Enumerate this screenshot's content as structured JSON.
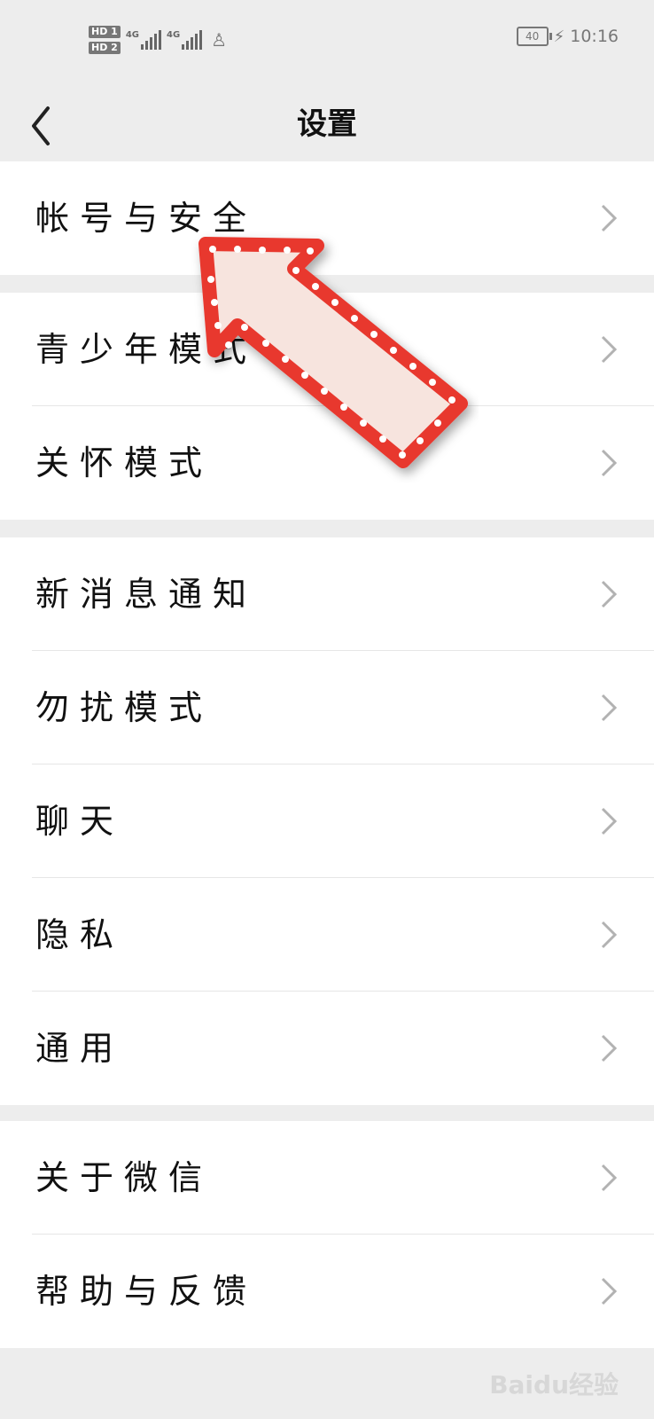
{
  "status_bar": {
    "sim1": "HD 1",
    "sim2": "HD 2",
    "net1": "4G",
    "net2": "4G",
    "battery": "40",
    "time": "10:16"
  },
  "header": {
    "title": "设置"
  },
  "settings": {
    "group1": [
      {
        "label": "帐号与安全"
      }
    ],
    "group2": [
      {
        "label": "青少年模式"
      },
      {
        "label": "关怀模式"
      }
    ],
    "group3": [
      {
        "label": "新消息通知"
      },
      {
        "label": "勿扰模式"
      },
      {
        "label": "聊天"
      },
      {
        "label": "隐私"
      },
      {
        "label": "通用"
      }
    ],
    "group4": [
      {
        "label": "关于微信"
      },
      {
        "label": "帮助与反馈"
      }
    ]
  },
  "watermark": "Baidu经验",
  "colors": {
    "background": "#ededed",
    "card": "#ffffff",
    "arrow_border": "#e8372f",
    "arrow_fill": "#f7e4de"
  }
}
